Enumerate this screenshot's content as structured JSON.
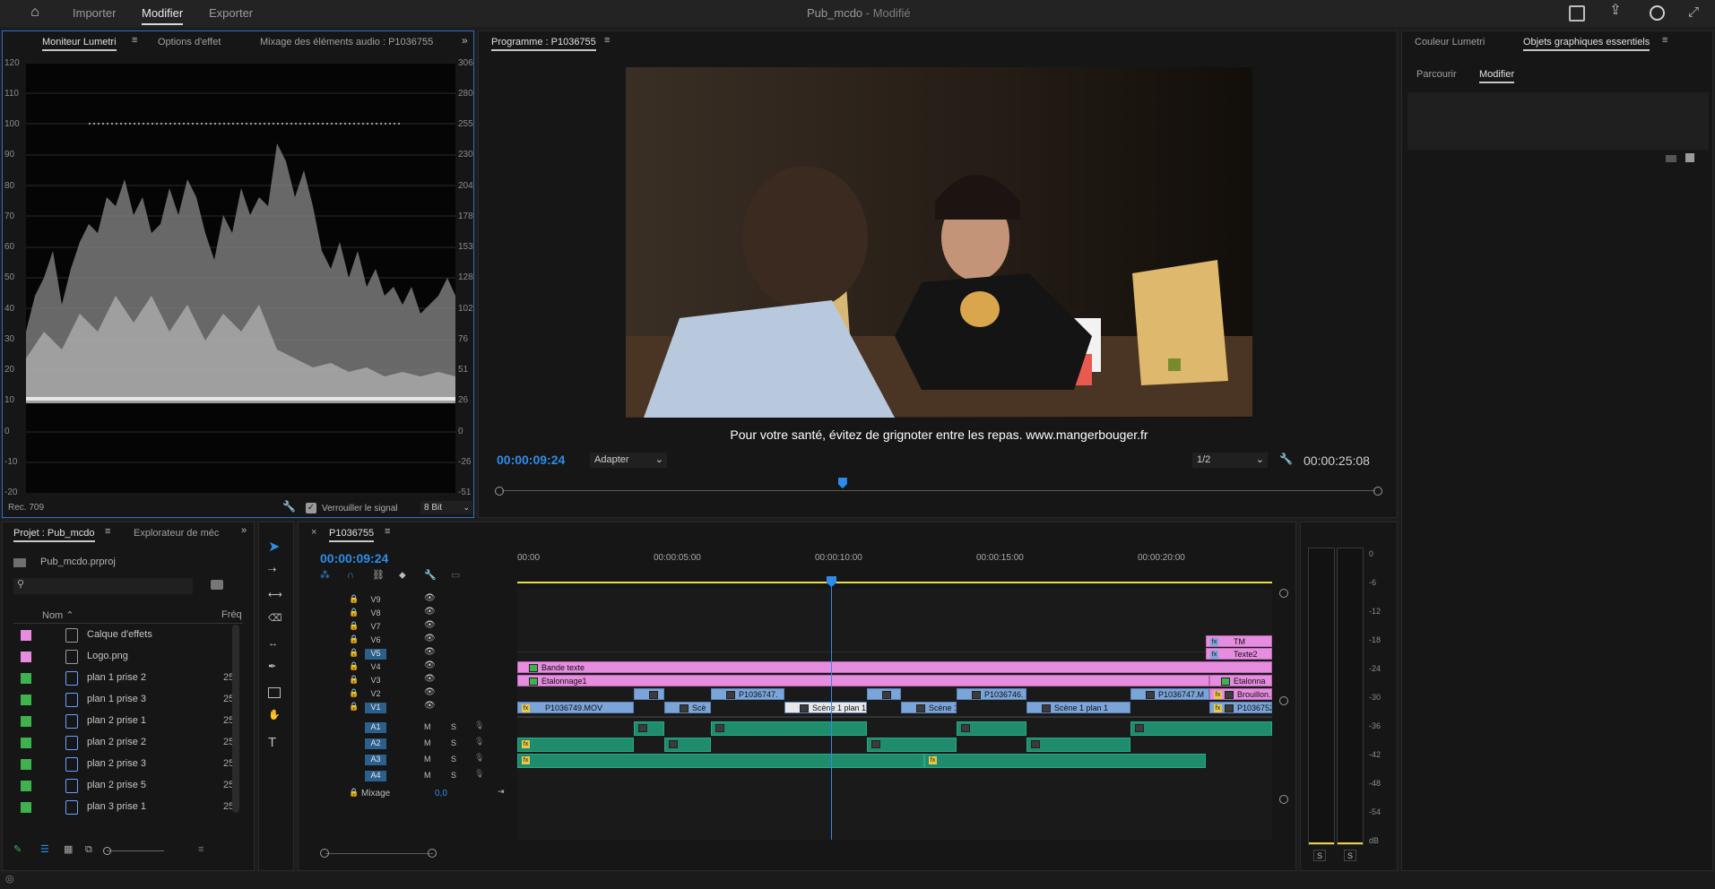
{
  "topbar": {
    "home_icon": "home-icon",
    "nav": [
      "Importer",
      "Modifier",
      "Exporter"
    ],
    "active_nav": "Modifier",
    "project_title": "Pub_mcdo",
    "status": " - Modifié"
  },
  "lumetri": {
    "tabs": [
      "Moniteur Lumetri",
      "Options d'effet",
      "Mixage des éléments audio : P1036755"
    ],
    "scale_left": [
      "120",
      "110",
      "100",
      "90",
      "80",
      "70",
      "60",
      "50",
      "40",
      "30",
      "20",
      "10",
      "0",
      "-10",
      "-20"
    ],
    "scale_right": [
      "306",
      "280",
      "255",
      "230",
      "204",
      "178",
      "153",
      "128",
      "102",
      "76",
      "51",
      "26",
      "0",
      "-26",
      "-51"
    ],
    "color_space": "Rec. 709",
    "lock_label": "Verrouiller le signal",
    "bit_depth": "8 Bit"
  },
  "program": {
    "title": "Programme : P1036755",
    "subtitle": "Pour votre santé, évitez de grignoter entre les repas. www.mangerbouger.fr",
    "timecode": "00:00:09:24",
    "fit": "Adapter",
    "resolution": "1/2",
    "duration": "00:00:25:08",
    "playhead_fraction": 0.39
  },
  "right_panel": {
    "tabs": [
      "Couleur Lumetri",
      "Objets graphiques essentiels"
    ],
    "subtabs": [
      "Parcourir",
      "Modifier"
    ]
  },
  "project": {
    "tabs": [
      "Projet : Pub_mcdo",
      "Explorateur de méc"
    ],
    "file": "Pub_mcdo.prproj",
    "col_name": "Nom",
    "col_freq": "Fréq",
    "items": [
      {
        "label": "Calque d'effets",
        "color": "#e68de0",
        "freq": ""
      },
      {
        "label": "Logo.png",
        "color": "#e68de0",
        "freq": ""
      },
      {
        "label": "plan 1 prise 2",
        "color": "#3fb24f",
        "freq": "25"
      },
      {
        "label": "plan 1 prise 3",
        "color": "#3fb24f",
        "freq": "25"
      },
      {
        "label": "plan 2 prise 1",
        "color": "#3fb24f",
        "freq": "25"
      },
      {
        "label": "plan 2 prise 2",
        "color": "#3fb24f",
        "freq": "25"
      },
      {
        "label": "plan 2 prise 3",
        "color": "#3fb24f",
        "freq": "25"
      },
      {
        "label": "plan 2 prise 5",
        "color": "#3fb24f",
        "freq": "25"
      },
      {
        "label": "plan 3 prise 1",
        "color": "#3fb24f",
        "freq": "25"
      }
    ]
  },
  "timeline": {
    "sequence": "P1036755",
    "timecode": "00:00:09:24",
    "ruler": [
      "00:00",
      "00:00:05:00",
      "00:00:10:00",
      "00:00:15:00",
      "00:00:20:00"
    ],
    "video_tracks": [
      "V9",
      "V8",
      "V7",
      "V6",
      "V5",
      "V4",
      "V3",
      "V2",
      "V1"
    ],
    "audio_tracks": [
      "A1",
      "A2",
      "A3",
      "A4"
    ],
    "mix_label": "Mixage",
    "mix_value": "0,0",
    "clips": {
      "tm": "TM",
      "texte2": "Texte2",
      "bande": "Bande texte",
      "etal1": "Etalonnage1",
      "etal2": "Etalonna",
      "v2a": "P1036747.",
      "v2b": "P1036746.",
      "v2c": "P1036747.M",
      "brouillon": "Brouillon.",
      "v1a": "P1036749.MOV",
      "v1b": "Scè",
      "v1c": "Scène 1 plan 1",
      "v1d": "Scène 1",
      "v1e": "Scène 1 plan 1",
      "v1f": "P1036752"
    }
  },
  "meter": {
    "labels": [
      "0",
      "-6",
      "-12",
      "-18",
      "-24",
      "-30",
      "-36",
      "-42",
      "-48",
      "-54",
      "dB"
    ],
    "solo": [
      "S",
      "S"
    ]
  }
}
